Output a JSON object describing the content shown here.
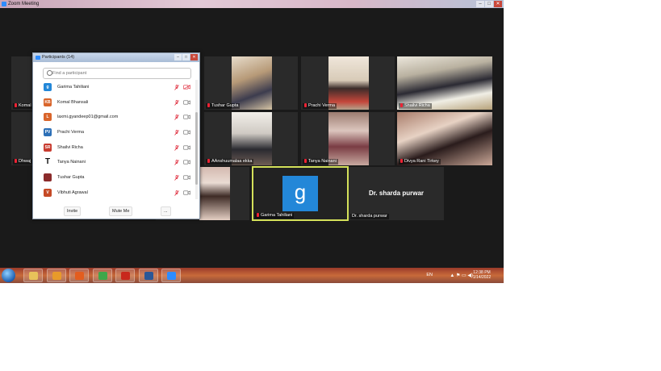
{
  "window": {
    "title": "Zoom Meeting",
    "controls": [
      "–",
      "□",
      "✕"
    ]
  },
  "gallery": {
    "tiles": [
      {
        "name": "Komal B"
      },
      {
        "name": "Tushar Gupta"
      },
      {
        "name": "Prachi Verma"
      },
      {
        "name": "Shailvi Richa"
      },
      {
        "name": "Dhwaj"
      },
      {
        "name": "AAnshuumalaa ekka"
      },
      {
        "name": "Tanya Nainani"
      },
      {
        "name": "Divya Rani Tirkey"
      },
      {
        "name": "Garima Tahiliani",
        "avatar_letter": "g"
      },
      {
        "name": "Dr. sharda purwar",
        "display_name": "Dr. sharda purwar"
      }
    ]
  },
  "participants_panel": {
    "title": "Participants (14)",
    "search_placeholder": "Find a participant",
    "participants": [
      {
        "initials": "g",
        "name": "Garima Tahiliani",
        "color": "#2387d8"
      },
      {
        "initials": "KB",
        "name": "Komal Bhansali",
        "color": "#d9652b"
      },
      {
        "initials": "L",
        "name": "laxmi.gyandeep01@gmail.com",
        "color": "#d9652b"
      },
      {
        "initials": "PV",
        "name": "Prachi Verma",
        "color": "#2c6fb7"
      },
      {
        "initials": "SR",
        "name": "Shailvi Richa",
        "color": "#c83b2f"
      },
      {
        "initials": "T",
        "name": "Tanya Nainani",
        "color": "transparent"
      },
      {
        "initials": "",
        "name": "Tushar Gupta",
        "color": "#8b2b2b"
      },
      {
        "initials": "V",
        "name": "Vibhuti Agrawal",
        "color": "#c54a26"
      }
    ],
    "footer": {
      "invite": "Invite",
      "mute_me": "Mute Me",
      "more": "..."
    }
  },
  "taskbar": {
    "language": "EN",
    "time": "12:38 PM",
    "date": "1/14/2022",
    "tray_icons": "▲ ⚑ ▭ ◀)",
    "apps": [
      {
        "icon": "folder-icon",
        "color": "#e8c25a"
      },
      {
        "icon": "media-player-icon",
        "color": "#e89a2a"
      },
      {
        "icon": "firefox-icon",
        "color": "#e35d1e"
      },
      {
        "icon": "chrome-icon",
        "color": "#3fa74a"
      },
      {
        "icon": "pdf-icon",
        "color": "#c8281c"
      },
      {
        "icon": "word-icon",
        "color": "#2b5797"
      },
      {
        "icon": "zoom-icon",
        "color": "#2d8cff"
      }
    ]
  }
}
